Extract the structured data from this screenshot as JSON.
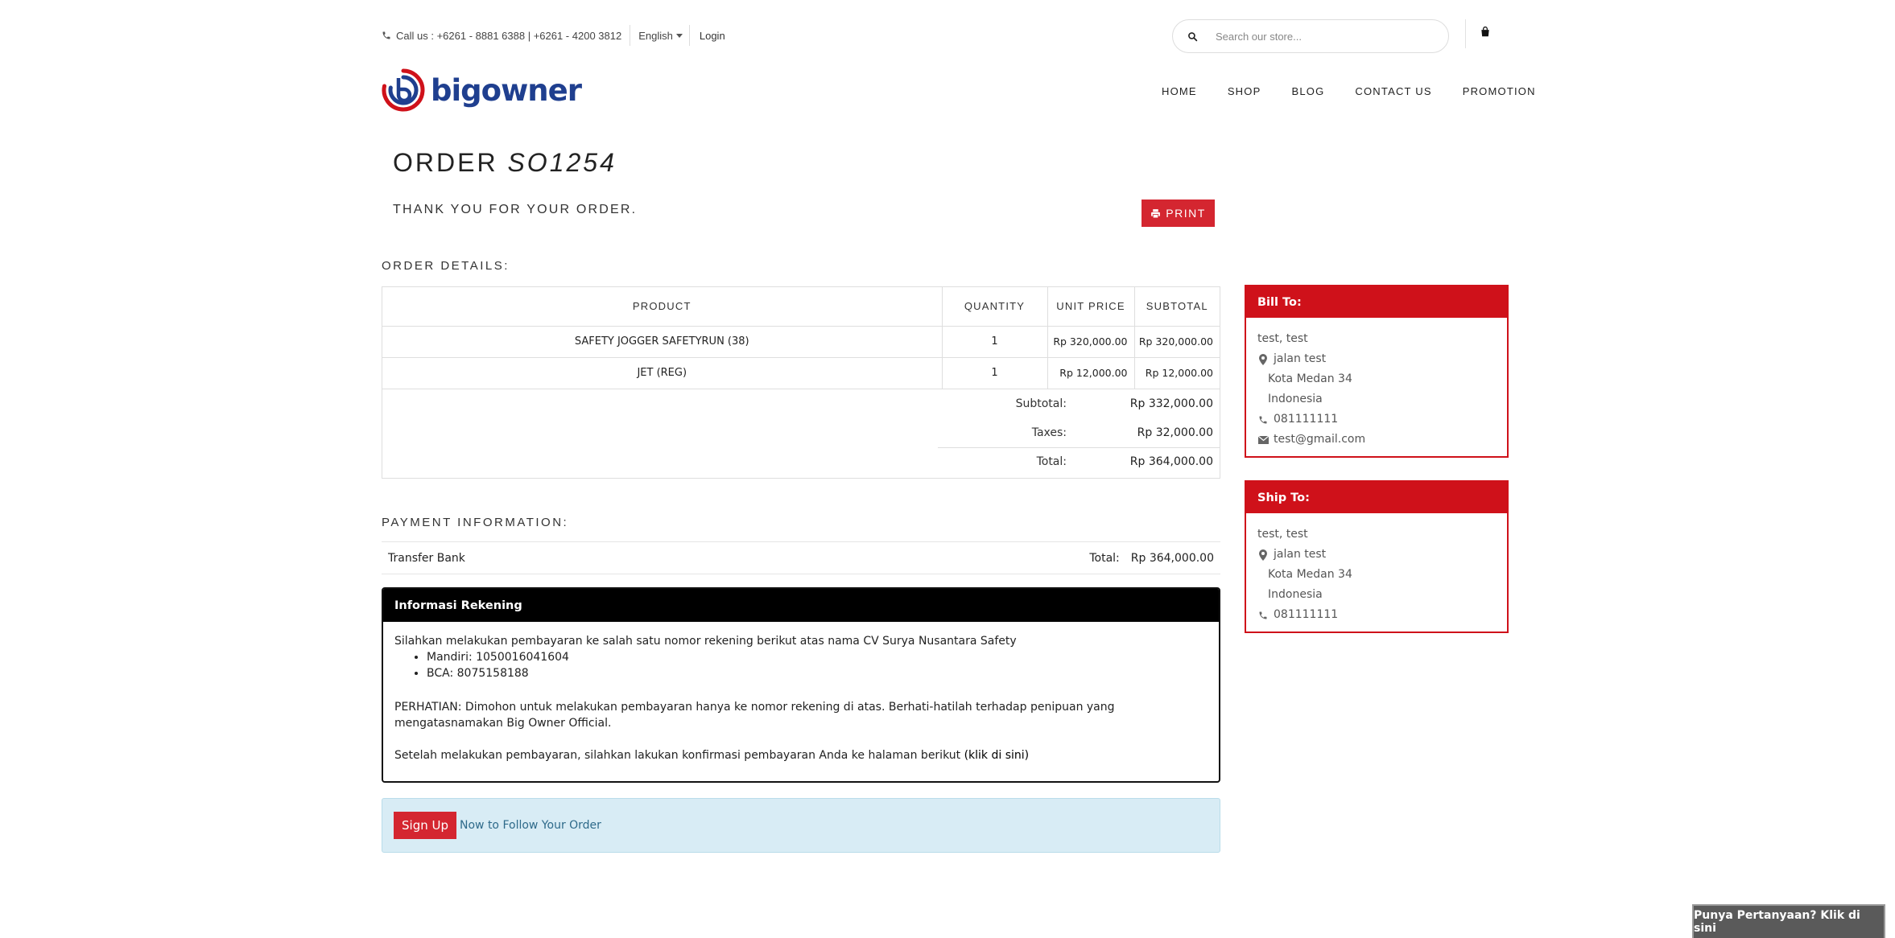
{
  "topbar": {
    "phone": "Call us : +6261 - 8881 6388 | +6261 - 4200 3812",
    "language": "English",
    "login": "Login"
  },
  "search": {
    "placeholder": "Search our store..."
  },
  "brand": {
    "name": "bigowner",
    "color": "#1f3f8f",
    "accent": "#cf111a"
  },
  "nav": [
    "HOME",
    "SHOP",
    "BLOG",
    "CONTACT US",
    "PROMOTION"
  ],
  "order": {
    "title_prefix": "ORDER",
    "number": "SO1254",
    "thanks": "THANK YOU FOR YOUR ORDER.",
    "print_label": "PRINT"
  },
  "details": {
    "title": "ORDER DETAILS:",
    "columns": [
      "PRODUCT",
      "QUANTITY",
      "UNIT PRICE",
      "SUBTOTAL"
    ],
    "rows": [
      {
        "product": "SAFETY JOGGER SAFETYRUN (38)",
        "qty": "1",
        "unit": "Rp 320,000.00",
        "subtotal": "Rp 320,000.00"
      },
      {
        "product": "JET (REG)",
        "qty": "1",
        "unit": "Rp 12,000.00",
        "subtotal": "Rp 12,000.00"
      }
    ],
    "subtotal_label": "Subtotal:",
    "subtotal_value": "Rp 332,000.00",
    "taxes_label": "Taxes:",
    "taxes_value": "Rp 32,000.00",
    "total_label": "Total:",
    "total_value": "Rp 364,000.00"
  },
  "payment": {
    "title": "PAYMENT INFORMATION:",
    "method": "Transfer Bank",
    "total_label": "Total:",
    "total_value": "Rp 364,000.00"
  },
  "info": {
    "title": "Informasi Rekening",
    "intro": "Silahkan melakukan pembayaran ke salah satu nomor rekening berikut atas nama CV Surya Nusantara Safety",
    "accounts": [
      "Mandiri: 1050016041604",
      "BCA: 8075158188"
    ],
    "warning": "PERHATIAN: Dimohon untuk melakukan pembayaran hanya ke nomor rekening di atas. Berhati-hatilah terhadap penipuan yang mengatasnamakan Big Owner Official.",
    "confirm_text": "Setelah melakukan pembayaran, silahkan lakukan konfirmasi pembayaran Anda ke halaman berikut",
    "confirm_link": "(klik di sini)"
  },
  "signup": {
    "button": "Sign Up",
    "message": "Now to Follow Your Order"
  },
  "bill_to": {
    "title": "Bill To:",
    "name": "test, test",
    "street": "jalan test",
    "city": "Kota Medan 34",
    "country": "Indonesia",
    "phone": "081111111",
    "email": "test@gmail.com"
  },
  "ship_to": {
    "title": "Ship To:",
    "name": "test, test",
    "street": "jalan test",
    "city": "Kota Medan 34",
    "country": "Indonesia",
    "phone": "081111111"
  },
  "chat": {
    "label": "Punya Pertanyaan? Klik di sini"
  }
}
